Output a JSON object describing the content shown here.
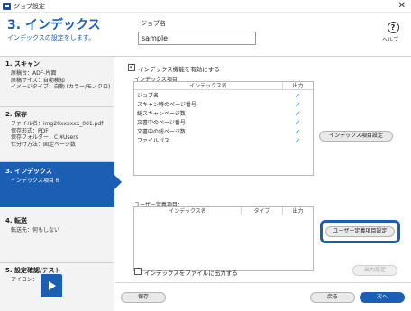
{
  "window": {
    "title": "ジョブ設定",
    "close_glyph": "✕"
  },
  "header": {
    "step_title": "3. インデックス",
    "step_subtitle": "インデックスの設定をします。",
    "job_name_label": "ジョブ名",
    "job_name_value": "sample",
    "help_glyph": "?",
    "help_label": "ヘルプ"
  },
  "sidebar": {
    "steps": [
      {
        "title": "1. スキャン",
        "details": [
          "原稿台：ADF-片面",
          "原稿サイズ：自動検知",
          "イメージタイプ：自動 (カラー/モノクロ)"
        ]
      },
      {
        "title": "2. 保存",
        "details": [
          "ファイル名：img20xxxxxx_001.pdf",
          "保存形式：PDF",
          "保存フォルダー：C:¥Users",
          "仕分け方法：固定ページ数"
        ]
      },
      {
        "title": "3. インデックス",
        "details": [
          "インデックス項目 6"
        ],
        "active": true
      },
      {
        "title": "4. 転送",
        "details": [
          "転送先：何もしない"
        ]
      },
      {
        "title": "5. 設定確認/テスト",
        "details": [
          "アイコン："
        ]
      }
    ]
  },
  "main": {
    "enable_index_label": "インデックス機能を有効にする",
    "enable_index_checked": true,
    "index_items_label": "インデックス項目",
    "index_table": {
      "columns": [
        "インデックス名",
        "出力"
      ],
      "rows": [
        {
          "name": "ジョブ名",
          "output": "✓"
        },
        {
          "name": "スキャン時のページ番号",
          "output": "✓"
        },
        {
          "name": "総スキャンページ数",
          "output": "✓"
        },
        {
          "name": "文書中のページ番号",
          "output": "✓"
        },
        {
          "name": "文書中の総ページ数",
          "output": "✓"
        },
        {
          "name": "ファイルパス",
          "output": "✓"
        }
      ]
    },
    "index_settings_button": "インデックス項目設定",
    "user_items_label": "ユーザー定義項目：",
    "user_table": {
      "columns": [
        "インデックス名",
        "タイプ",
        "出力"
      ],
      "rows": []
    },
    "user_settings_button": "ユーザー定義項目設定",
    "output_to_file_label": "インデックスをファイルに出力する",
    "output_to_file_checked": false,
    "output_settings_button": "出力設定",
    "save_button": "保存",
    "back_button": "戻る",
    "next_button": "次へ"
  }
}
